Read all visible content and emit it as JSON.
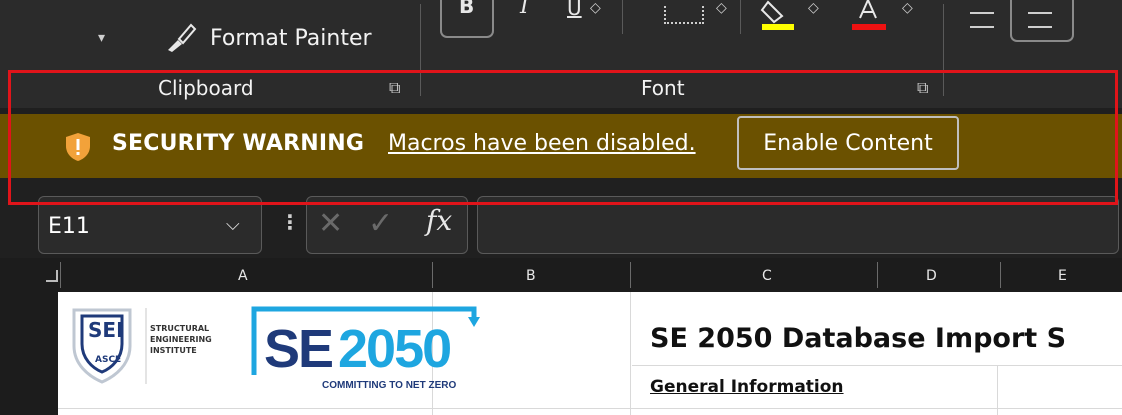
{
  "ribbon": {
    "format_painter_label": "Format Painter",
    "groups": {
      "clipboard": "Clipboard",
      "font": "Font"
    }
  },
  "security_bar": {
    "title": "SECURITY WARNING",
    "message": "Macros have been disabled.",
    "button_label": "Enable Content",
    "bar_color": "#6b5100",
    "highlight_color": "#e0141a"
  },
  "formula_bar": {
    "name_box": "E11",
    "fx_label": "fx",
    "formula": ""
  },
  "columns": [
    "A",
    "B",
    "C",
    "D",
    "E"
  ],
  "sheet": {
    "sei_logo": {
      "badge": "SEI",
      "badge_sub": "ASCE",
      "lines": [
        "STRUCTURAL",
        "ENGINEERING",
        "INSTITUTE"
      ]
    },
    "se2050_logo": {
      "text_se": "SE",
      "text_num": "2050",
      "tagline": "COMMITTING TO NET ZERO"
    },
    "title": "SE 2050 Database Import S",
    "section_heading": "General Information"
  }
}
